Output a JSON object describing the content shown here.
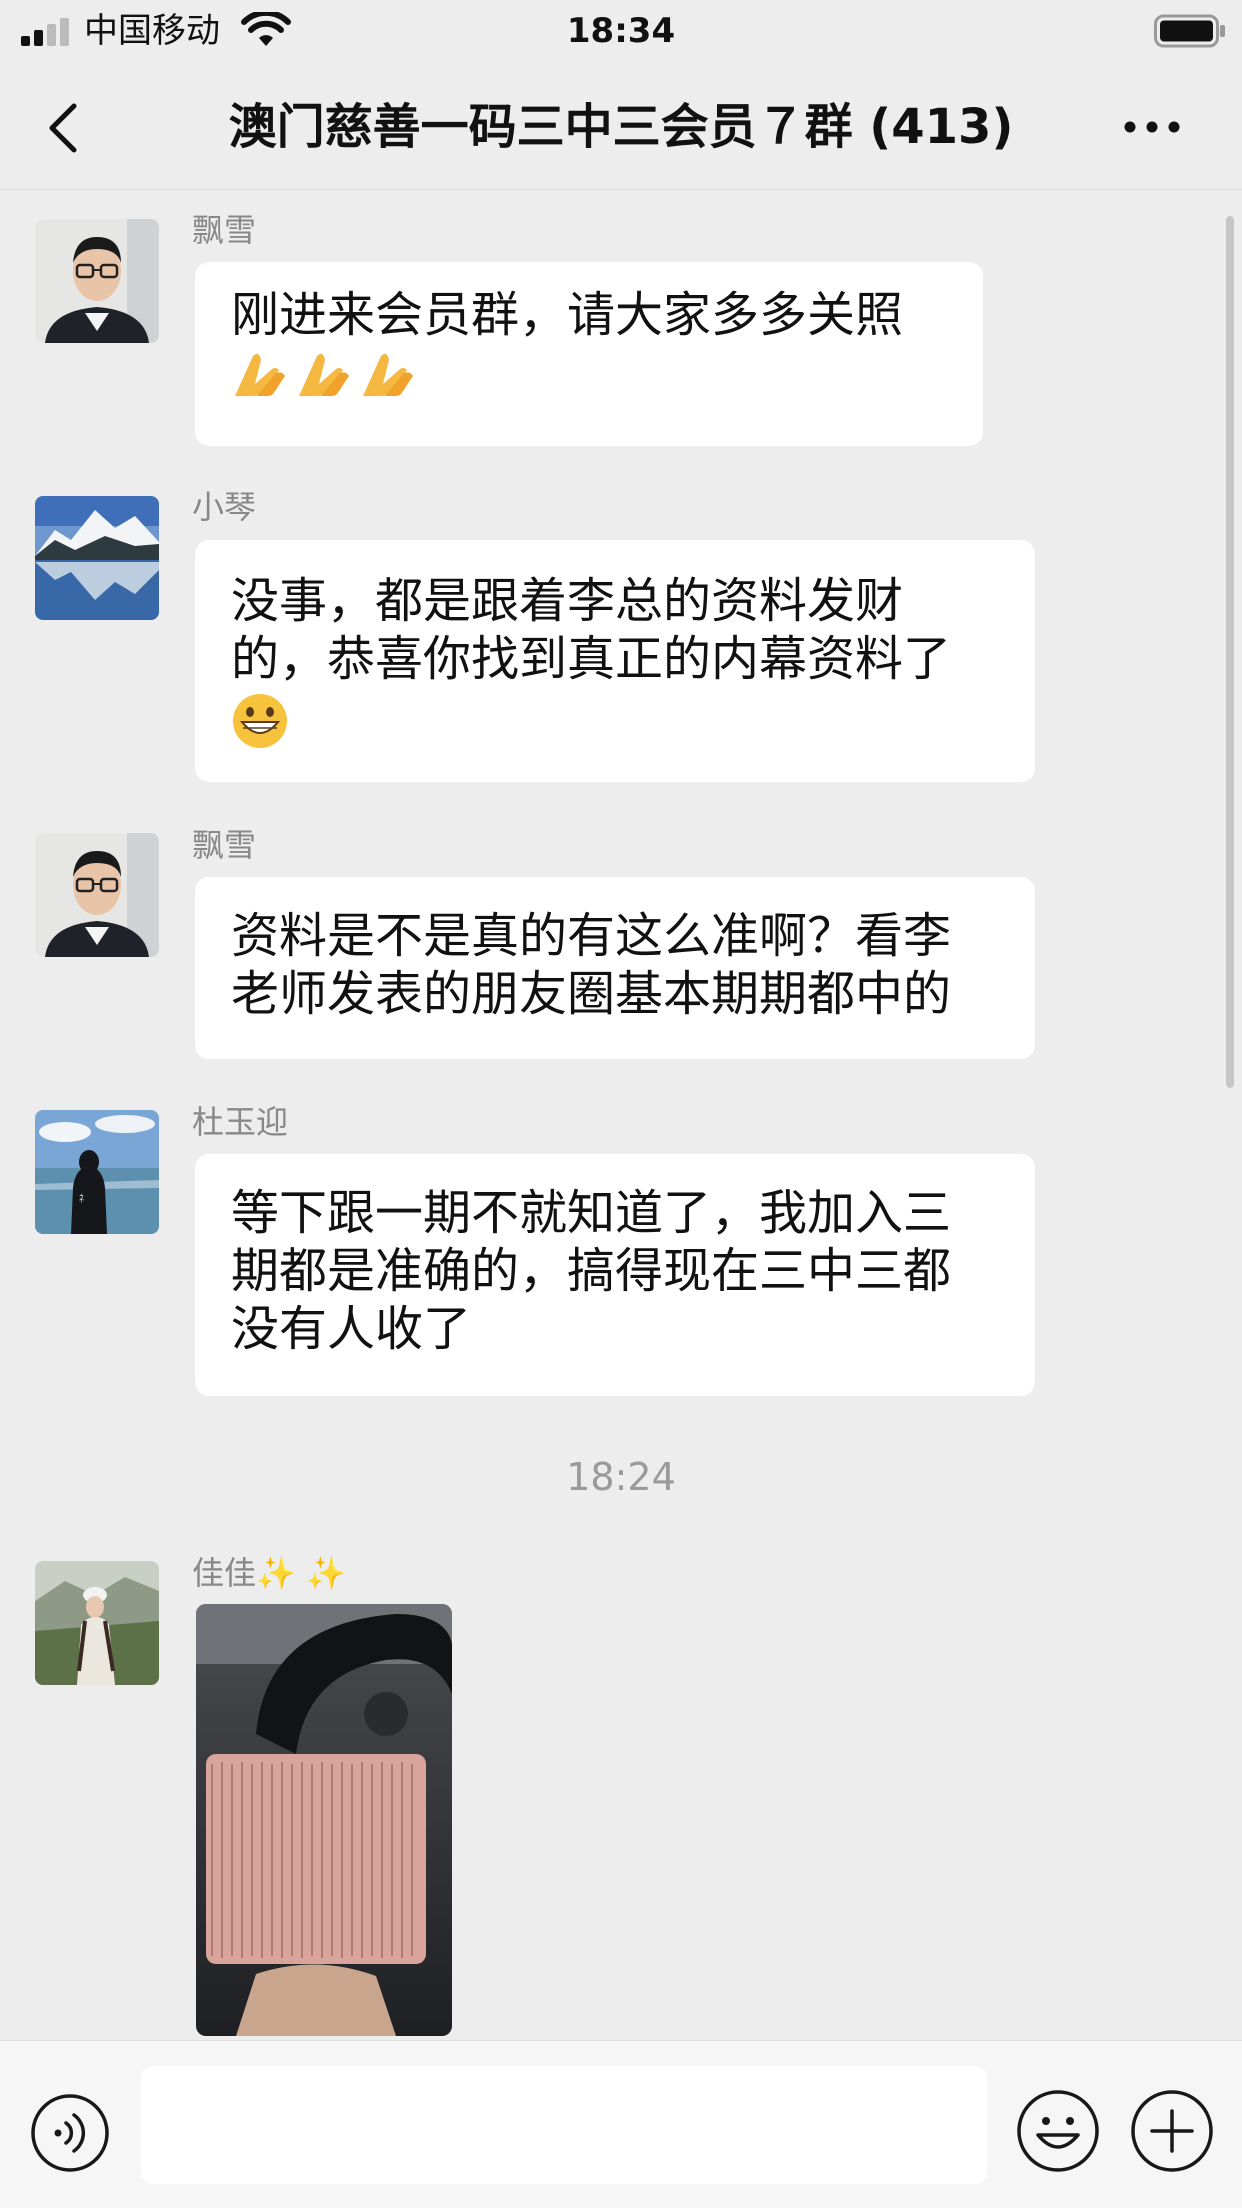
{
  "status": {
    "carrier": "中国移动",
    "time": "18:34"
  },
  "header": {
    "title": "澳门慈善一码三中三会员７群 (413)"
  },
  "messages": [
    {
      "sender": "飘雪",
      "lines": [
        "刚进来会员群，请大家多多关照"
      ],
      "emojis": [
        "folded-hands",
        "folded-hands",
        "folded-hands"
      ]
    },
    {
      "sender": "小琴",
      "lines": [
        "没事，都是跟着李总的资料发财",
        "的，恭喜你找到真正的内幕资料了"
      ],
      "emojis": [
        "grinning-face"
      ]
    },
    {
      "sender": "飘雪",
      "lines": [
        "资料是不是真的有这么准啊？看李",
        "老师发表的朋友圈基本期期都中的"
      ],
      "emojis": []
    },
    {
      "sender": "杜玉迎",
      "lines": [
        "等下跟一期不就知道了，我加入三",
        "期都是准确的，搞得现在三中三都",
        "没有人收了"
      ],
      "emojis": []
    }
  ],
  "timestamp": "18:24",
  "photo_message": {
    "sender": "佳佳✨ ✨"
  },
  "input": {
    "value": "",
    "placeholder": ""
  },
  "colors": {
    "background": "#ededed",
    "bubble": "#ffffff",
    "sender_text": "#888888",
    "timestamp_text": "#9a9a9a"
  },
  "icons": [
    "back-icon",
    "more-icon",
    "voice-icon",
    "emoji-icon",
    "plus-icon"
  ]
}
